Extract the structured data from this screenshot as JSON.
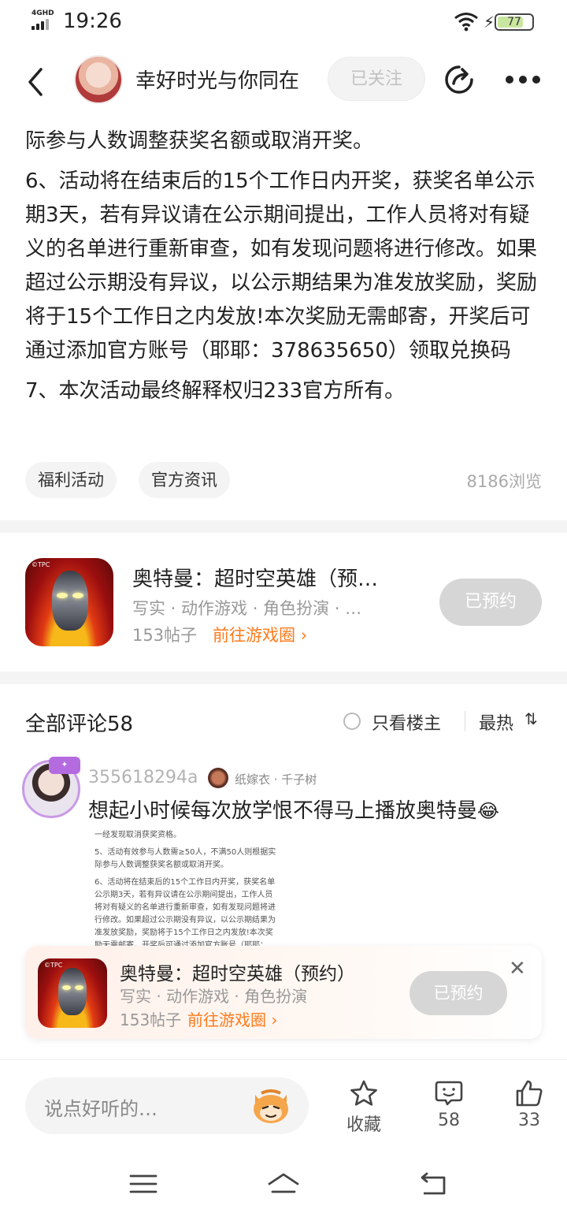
{
  "status_bar": {
    "network": "4GHD",
    "time": "19:26",
    "battery": "77",
    "battery_level": 0.77
  },
  "header": {
    "username": "幸好时光与你同在",
    "follow_label": "已关注"
  },
  "article": {
    "paragraphs": [
      "际参与人数调整获奖名额或取消开奖。",
      "6、活动将在结束后的15个工作日内开奖，获奖名单公示期3天，若有异议请在公示期间提出，工作人员将对有疑义的名单进行重新审查，如有发现问题将进行修改。如果超过公示期没有异议，以公示期结果为准发放奖励，奖励将于15个工作日之内发放!本次奖励无需邮寄，开奖后可通过添加官方账号（耶耶：378635650）领取兑换码",
      "7、本次活动最终解释权归233官方所有。"
    ],
    "tags": [
      "福利活动",
      "官方资讯"
    ],
    "views": "8186浏览"
  },
  "game_card": {
    "title": "奥特曼：超时空英雄（预…",
    "genres": "写实 · 动作游戏 · 角色扮演 · …",
    "posts": "153帖子",
    "link": "前往游戏圈",
    "reserve_label": "已预约",
    "icon_badge": "©TPC"
  },
  "comments": {
    "title": "全部评论58",
    "only_host": "只看楼主",
    "sort": "最热",
    "items": [
      {
        "user": "355618294a",
        "user_title": "纸嫁衣 · 千子树",
        "text": "想起小时候每次放学恨不得马上播放奥特曼",
        "emoji": "😂",
        "image_lines": [
          "一经发现取消获奖资格。",
          "5、活动有效参与人数需≥50人，不满50人则根据实际参与人数调整获奖名额或取消开奖。",
          "6、活动将在结束后的15个工作日内开奖，获奖名单公示期3天，若有异议请在公示期间提出，工作人员将对有疑义的名单进行重新审查，如有发现问题将进行修改。如果超过公示期没有异议，以公示期结果为准发放奖励，奖励将于15个工作日之内发放!本次奖励无需邮寄，开奖后可通过添加官方账号（耶耶："
        ]
      }
    ]
  },
  "floating_card": {
    "title": "奥特曼：超时空英雄（预约）",
    "genres": "写实 · 动作游戏 · 角色扮演",
    "posts": "153帖子",
    "link": "前往游戏圈",
    "reserve_label": "已预约",
    "close": "✕",
    "icon_badge": "©TPC"
  },
  "bottom_bar": {
    "input_placeholder": "说点好听的…",
    "favorite_label": "收藏",
    "comment_count": "58",
    "like_count": "33"
  },
  "colors": {
    "accent": "#ff7a1a",
    "disabled_button": "#d6d6d6",
    "divider": "#f4f4f4"
  }
}
